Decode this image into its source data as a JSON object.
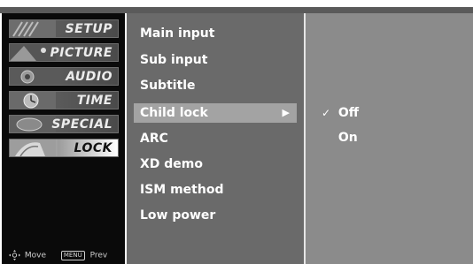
{
  "sidebar": {
    "items": [
      {
        "label": "SETUP",
        "icon": "setup-thumbnail-icon",
        "selected": false
      },
      {
        "label": "PICTURE",
        "icon": "picture-thumbnail-icon",
        "selected": false
      },
      {
        "label": "AUDIO",
        "icon": "audio-thumbnail-icon",
        "selected": false
      },
      {
        "label": "TIME",
        "icon": "time-thumbnail-icon",
        "selected": false
      },
      {
        "label": "SPECIAL",
        "icon": "special-thumbnail-icon",
        "selected": false
      },
      {
        "label": "LOCK",
        "icon": "lock-thumbnail-icon",
        "selected": true
      }
    ],
    "legend": {
      "move_icon": "dpad-icon",
      "move_label": "Move",
      "menu_key_label": "MENU",
      "prev_label": "Prev"
    }
  },
  "menu": {
    "items": [
      {
        "label": "Main input",
        "selected": false
      },
      {
        "label": "Sub input",
        "selected": false
      },
      {
        "label": "Subtitle",
        "selected": false
      },
      {
        "label": "Child lock",
        "selected": true,
        "arrow": "▶"
      },
      {
        "label": "ARC",
        "selected": false
      },
      {
        "label": "XD demo",
        "selected": false
      },
      {
        "label": "ISM method",
        "selected": false
      },
      {
        "label": "Low power",
        "selected": false
      }
    ]
  },
  "submenu": {
    "items": [
      {
        "label": "Off",
        "checked": true,
        "check": "✓"
      },
      {
        "label": "On",
        "checked": false,
        "check": ""
      }
    ]
  },
  "colors": {
    "sidebar_bg": "#0a0a0a",
    "menu_bg": "#6a6a6a",
    "submenu_bg": "#8b8b8b",
    "highlight_bg": "#a3a3a3",
    "text": "#ffffff"
  }
}
